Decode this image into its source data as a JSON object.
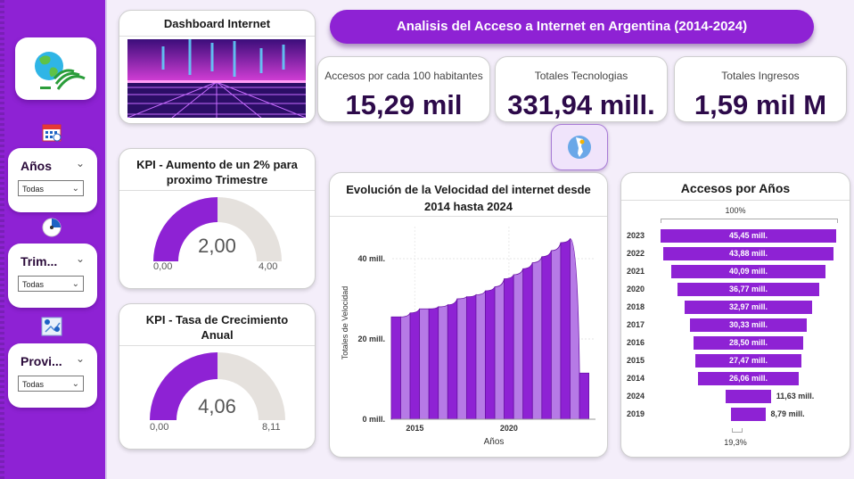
{
  "sidebar": {
    "filters": [
      {
        "label": "Años",
        "value": "Todas"
      },
      {
        "label": "Trim...",
        "value": "Todas"
      },
      {
        "label": "Provi...",
        "value": "Todas"
      }
    ]
  },
  "banner": {
    "title": "Dashboard Internet"
  },
  "header": {
    "title": "Analisis del Acceso a Internet en Argentina (2014-2024)"
  },
  "kpis": [
    {
      "label": "Accesos por cada 100 habitantes",
      "value": "15,29 mil"
    },
    {
      "label": "Totales Tecnologias",
      "value": "331,94 mill."
    },
    {
      "label": "Totales Ingresos",
      "value": "1,59 mil M"
    }
  ],
  "gauges": [
    {
      "title": "KPI - Aumento de un 2% para proximo Trimestre",
      "value_label": "2,00",
      "min_label": "0,00",
      "max_label": "4,00",
      "fraction": 0.5
    },
    {
      "title": "KPI - Tasa de Crecimiento Anual",
      "value_label": "4,06",
      "min_label": "0,00",
      "max_label": "8,11",
      "fraction": 0.5
    }
  ],
  "chart_data": [
    {
      "type": "area",
      "title": "Evolución de la Velocidad del internet desde 2014 hasta 2024",
      "xlabel": "Años",
      "ylabel": "Totales de Velocidad",
      "ytick_labels": [
        "0 mill.",
        "20 mill.",
        "40 mill."
      ],
      "yticks": [
        0,
        20,
        40
      ],
      "ylim": [
        0,
        48
      ],
      "xtick_labels": [
        "2015",
        "2020"
      ],
      "xticks": [
        2015,
        2020
      ],
      "xlim": [
        2013.8,
        2024.6
      ],
      "x": [
        2014.0,
        2014.5,
        2015.0,
        2015.5,
        2016.0,
        2016.5,
        2017.0,
        2017.5,
        2018.0,
        2018.5,
        2019.0,
        2019.5,
        2020.0,
        2020.5,
        2021.0,
        2021.5,
        2022.0,
        2022.5,
        2023.0,
        2023.5,
        2024.0
      ],
      "values": [
        25.5,
        25.5,
        26.5,
        27.5,
        27.5,
        28.0,
        28.5,
        30.0,
        30.5,
        31.0,
        32.0,
        33.0,
        35.0,
        36.0,
        37.5,
        39.0,
        40.5,
        42.0,
        44.0,
        45.0,
        11.5
      ]
    },
    {
      "type": "bar",
      "title": "Accesos por Años",
      "top_label": "100%",
      "bottom_label": "19,3%",
      "categories": [
        "2023",
        "2022",
        "2021",
        "2020",
        "2018",
        "2017",
        "2016",
        "2015",
        "2014",
        "2024",
        "2019"
      ],
      "values": [
        45.45,
        43.88,
        40.09,
        36.77,
        32.97,
        30.33,
        28.5,
        27.47,
        26.06,
        11.63,
        8.79
      ],
      "value_labels": [
        "45,45 mill.",
        "43,88 mill.",
        "40,09 mill.",
        "36,77 mill.",
        "32,97 mill.",
        "30,33 mill.",
        "28,50 mill.",
        "27,47 mill.",
        "26,06 mill.",
        "11,63 mill.",
        "8,79 mill."
      ]
    }
  ],
  "colors": {
    "accent": "#8e22d4",
    "accent_light": "#b67ae6",
    "gauge_bg": "#e5e1dd"
  }
}
